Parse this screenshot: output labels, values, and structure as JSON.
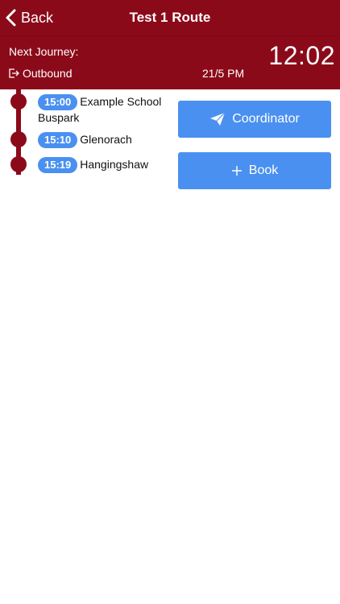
{
  "nav": {
    "back_label": "Back",
    "title": "Test 1 Route"
  },
  "journey": {
    "next_label": "Next Journey:",
    "direction": "Outbound",
    "date": "21/5 PM",
    "time": "12:02"
  },
  "stops": [
    {
      "time": "15:00",
      "name": "Example School Buspark"
    },
    {
      "time": "15:10",
      "name": "Glenorach"
    },
    {
      "time": "15:19",
      "name": "Hangingshaw"
    }
  ],
  "actions": {
    "coordinator_label": "Coordinator",
    "book_label": "Book"
  },
  "colors": {
    "brand": "#8b0a1a",
    "accent": "#4a90f0"
  },
  "icons": {
    "back": "chevron-left-icon",
    "direction": "exit-arrow-icon",
    "coordinator": "paper-plane-icon",
    "book": "plus-icon"
  }
}
